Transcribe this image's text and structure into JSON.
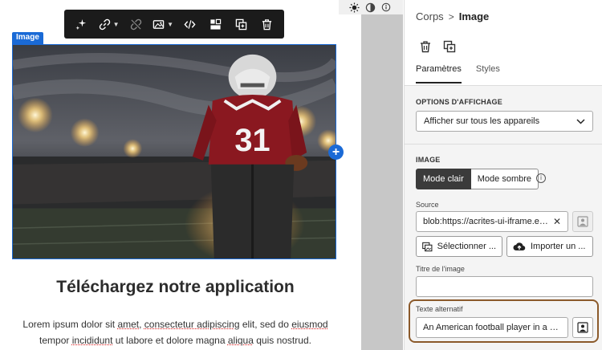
{
  "toolbar": {
    "buttons": [
      "ai-sparkle-icon",
      "link-icon",
      "unlink-icon",
      "image-icon",
      "code-icon",
      "layout-icon",
      "duplicate-icon",
      "delete-icon"
    ]
  },
  "canvas": {
    "image_badge": "Image",
    "heading": "Téléchargez notre application",
    "body": {
      "p1": "Lorem ipsum dolor sit ",
      "w_amet": "amet",
      "p2": ", ",
      "w_consectetur": "consectetur adipiscing",
      "p3": " elit, sed do ",
      "w_eiusmod": "eiusmod",
      "p4": " tempor ",
      "w_incididunt": "incididunt",
      "p5": " ut labore et dolore magna ",
      "w_aliqua": "aliqua",
      "p6": " quis nostrud."
    },
    "image_jersey_number": "31"
  },
  "panel": {
    "breadcrumb": {
      "parent": "Corps",
      "separator": ">",
      "current": "Image"
    },
    "tabs": {
      "params": "Paramètres",
      "styles": "Styles"
    },
    "display": {
      "title": "OPTIONS D'AFFICHAGE",
      "select_value": "Afficher sur tous les appareils"
    },
    "image": {
      "title": "IMAGE",
      "mode_light": "Mode clair",
      "mode_dark": "Mode sombre",
      "source_label": "Source",
      "source_value": "blob:https://acrites-ui-iframe.exp...",
      "select_btn": "Sélectionner ...",
      "import_btn": "Importer un ...",
      "title_label": "Titre de l'image",
      "title_value": "",
      "alt_label": "Texte alternatif",
      "alt_value": "An American football player in a sta..."
    }
  },
  "colors": {
    "accent": "#1a6ad6",
    "toolbar_bg": "#1b1b1b",
    "highlight_border": "#8b5a2b"
  }
}
